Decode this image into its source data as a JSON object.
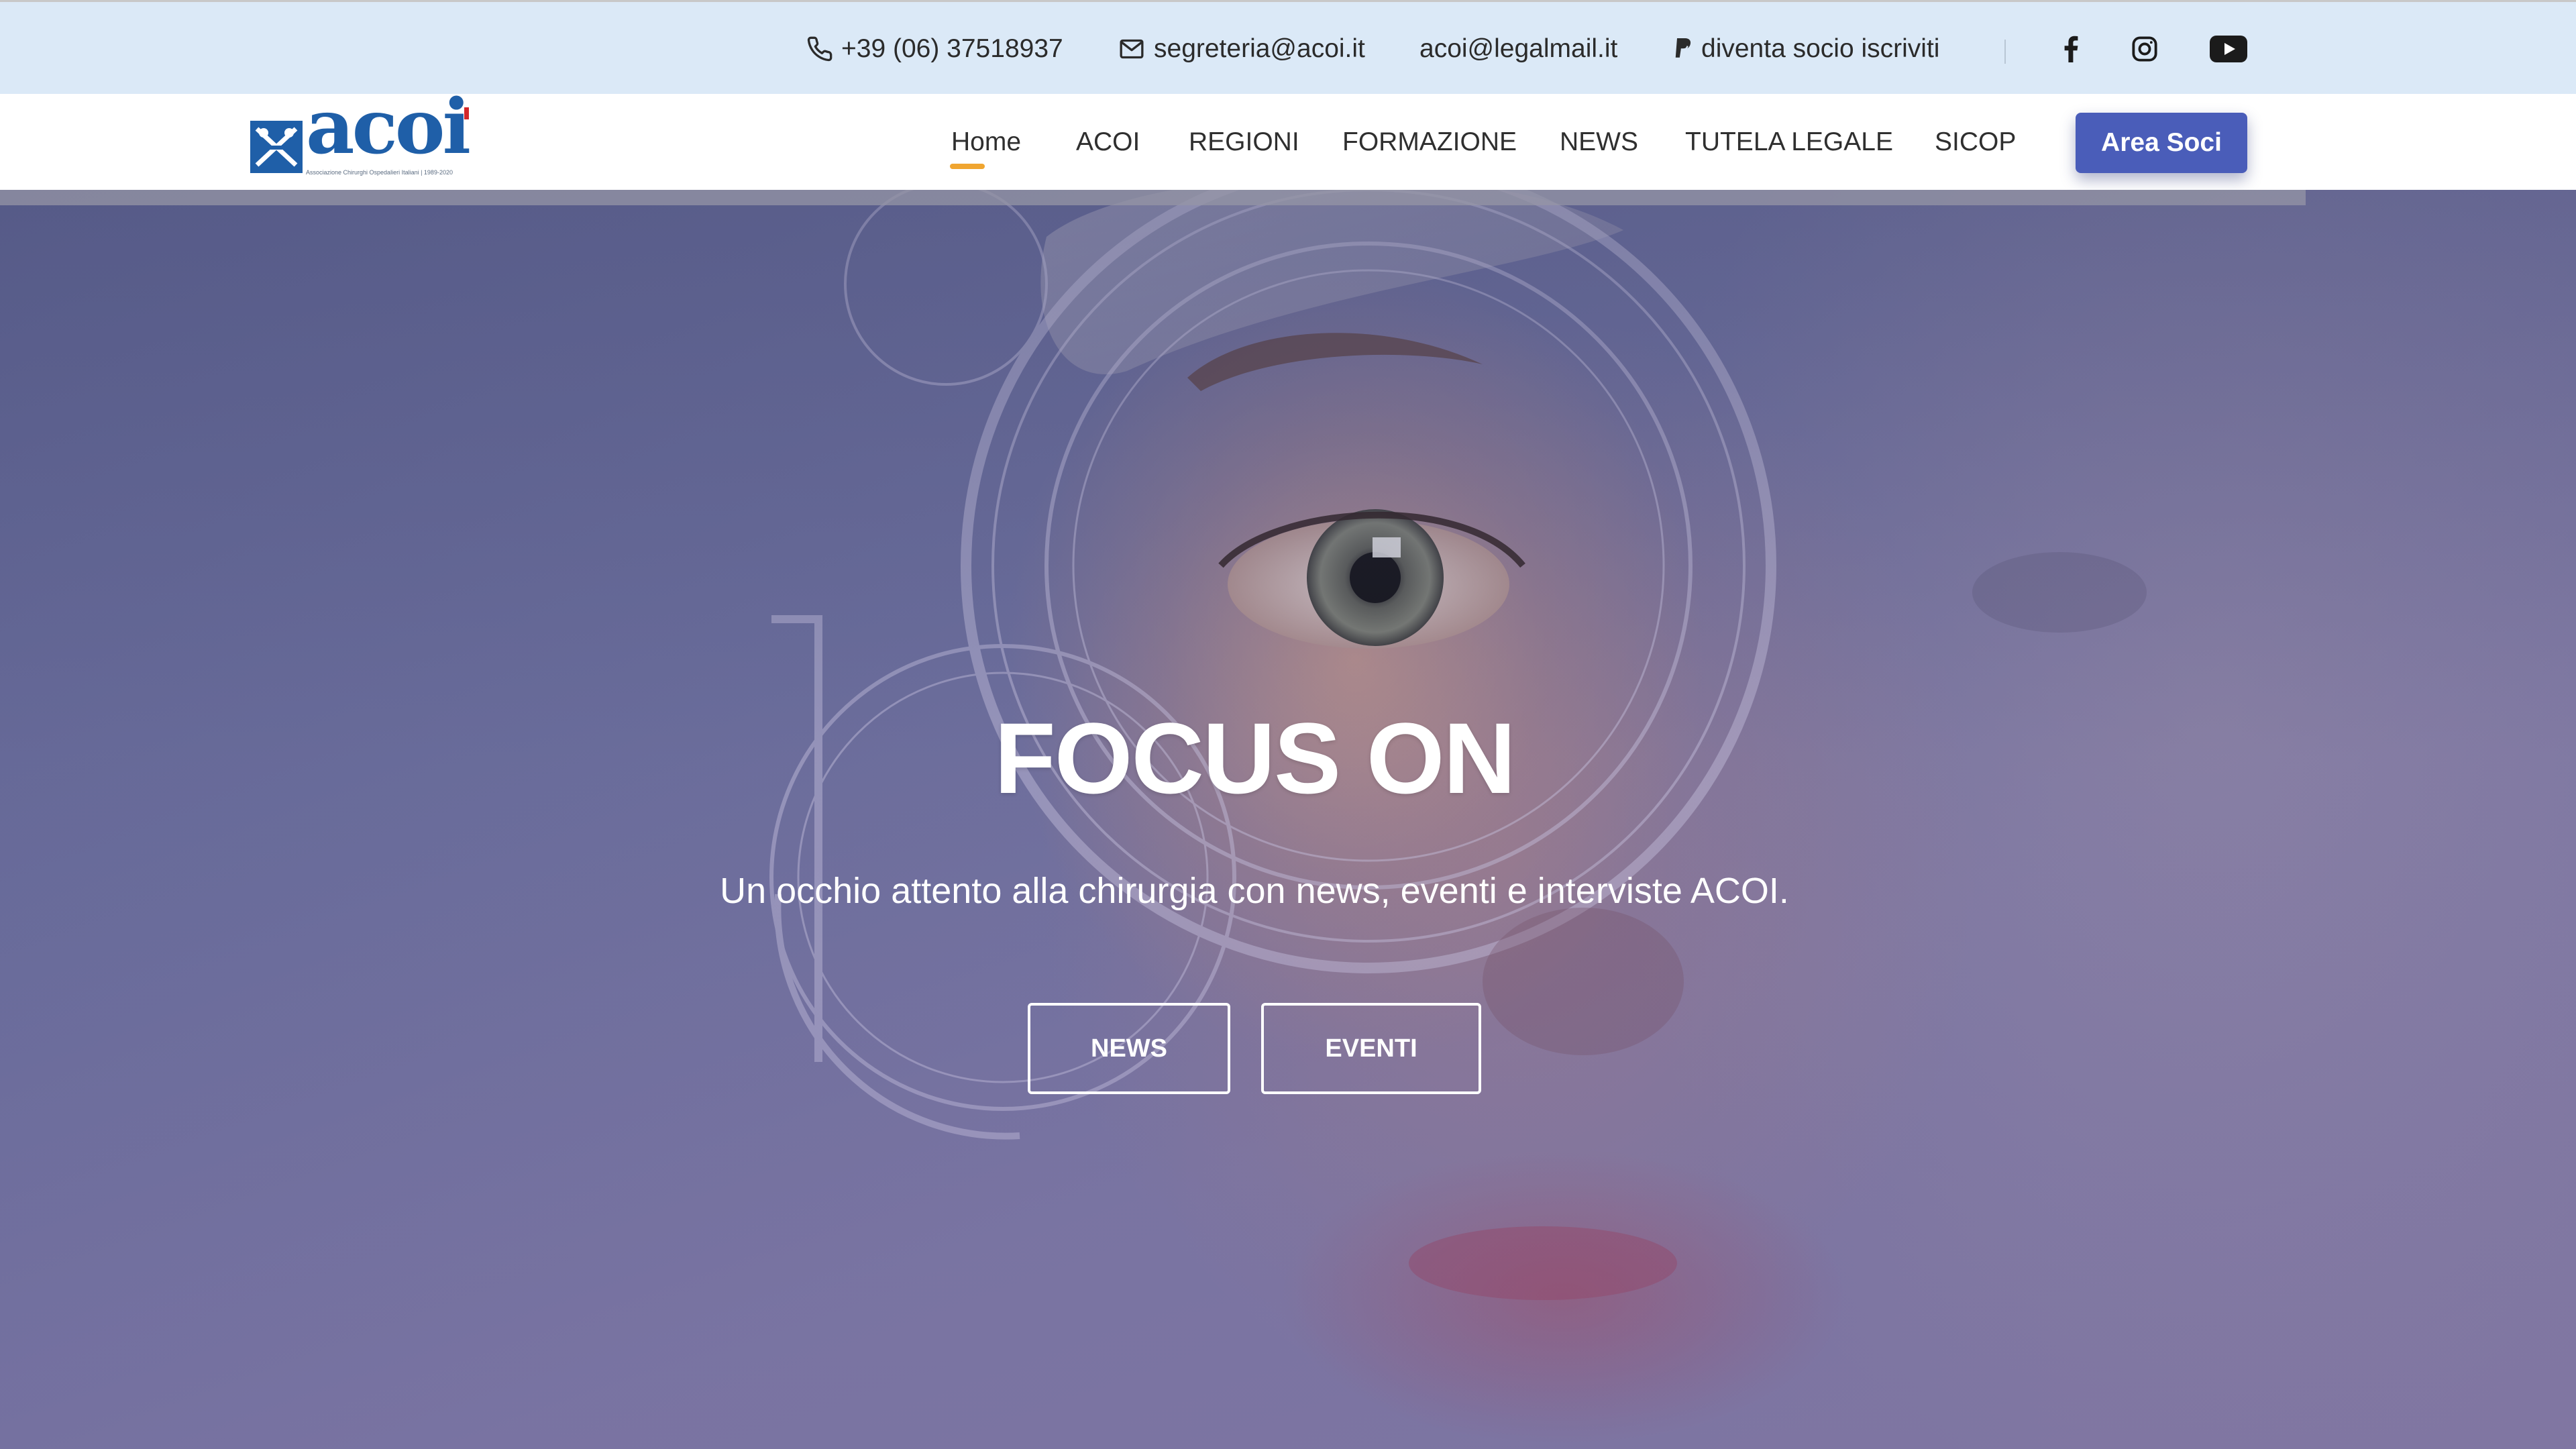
{
  "topbar": {
    "phone": "+39 (06) 37518937",
    "email": "segreteria@acoi.it",
    "pec": "acoi@legalmail.it",
    "join": "diventa socio iscriviti",
    "social": [
      "facebook-icon",
      "instagram-icon",
      "youtube-icon"
    ]
  },
  "logo": {
    "wordmark": "acoi",
    "tagline": "Associazione Chirurghi Ospedalieri Italiani | 1989-2020"
  },
  "nav": {
    "items": [
      "Home",
      "ACOI",
      "REGIONI",
      "FORMAZIONE",
      "NEWS",
      "TUTELA LEGALE",
      "SICOP"
    ],
    "active": "Home",
    "cta": "Area Soci"
  },
  "hero": {
    "title": "FOCUS ON",
    "subtitle": "Un occhio attento alla chirurgia con news, eventi e interviste ACOI.",
    "buttons": [
      "NEWS",
      "EVENTI"
    ]
  },
  "colors": {
    "topbar_bg": "#dbe9f7",
    "brand_blue": "#1f5fa8",
    "cta_bg": "#4a5db9",
    "active_underline": "#f0a530"
  }
}
